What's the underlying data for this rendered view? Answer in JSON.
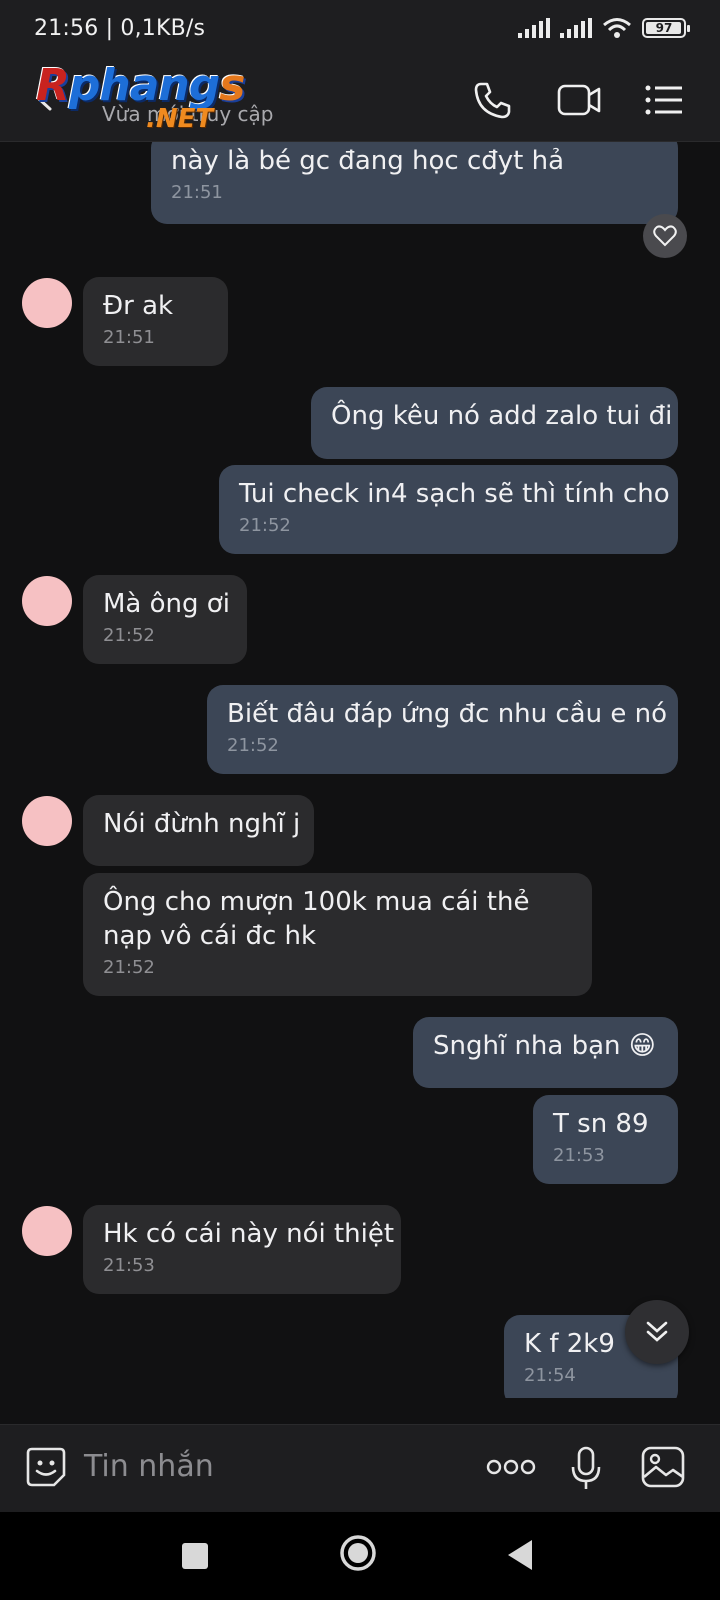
{
  "status_bar": {
    "time_speed": "21:56 | 0,1KB/s",
    "battery": "97",
    "battery_level": 0.97,
    "icons": [
      "signal-icon",
      "signal-icon",
      "wifi-icon",
      "battery-icon"
    ]
  },
  "header": {
    "logo_text": "Rphangs",
    "logo_suffix": ".NET",
    "subtitle": "Vừa mới truy cập",
    "icons": [
      "back-arrow-icon",
      "phone-icon",
      "video-call-icon",
      "menu-list-icon"
    ]
  },
  "messages": [
    {
      "dir": "out",
      "text": "này là bé gc đang học cđyt hả",
      "time": "21:51"
    },
    {
      "dir": "in",
      "text": "Đr ak",
      "time": "21:51"
    },
    {
      "dir": "out",
      "text": "Ông kêu nó add zalo tui đi",
      "time": ""
    },
    {
      "dir": "out",
      "text": "Tui check in4 sạch sẽ thì tính cho",
      "time": "21:52"
    },
    {
      "dir": "in",
      "text": "Mà ông ơi",
      "time": "21:52"
    },
    {
      "dir": "out",
      "text": "Biết đâu đáp ứng đc nhu cầu e nó",
      "time": "21:52"
    },
    {
      "dir": "in",
      "text": "Nói đừnh nghĩ j",
      "time": ""
    },
    {
      "dir": "in",
      "text": "Ông cho mượn 100k mua cái thẻ nạp vô cái đc hk",
      "time": "21:52"
    },
    {
      "dir": "out",
      "text": "Snghĩ nha bạn 😁",
      "time": ""
    },
    {
      "dir": "out",
      "text": "T sn 89",
      "time": "21:53"
    },
    {
      "dir": "in",
      "text": "Hk có cái này nói thiệt",
      "time": "21:53"
    },
    {
      "dir": "out",
      "text": "K f 2k9",
      "time": "21:54"
    }
  ],
  "input": {
    "placeholder": "Tin nhắn",
    "icons": [
      "sticker-icon",
      "more-dots-icon",
      "microphone-icon",
      "image-icon"
    ]
  },
  "colors": {
    "background": "#111112",
    "bar": "#1e1e20",
    "outgoing_bubble": "#3c4656",
    "incoming_bubble": "#2b2b2d",
    "avatar": "#f6c1c3"
  }
}
